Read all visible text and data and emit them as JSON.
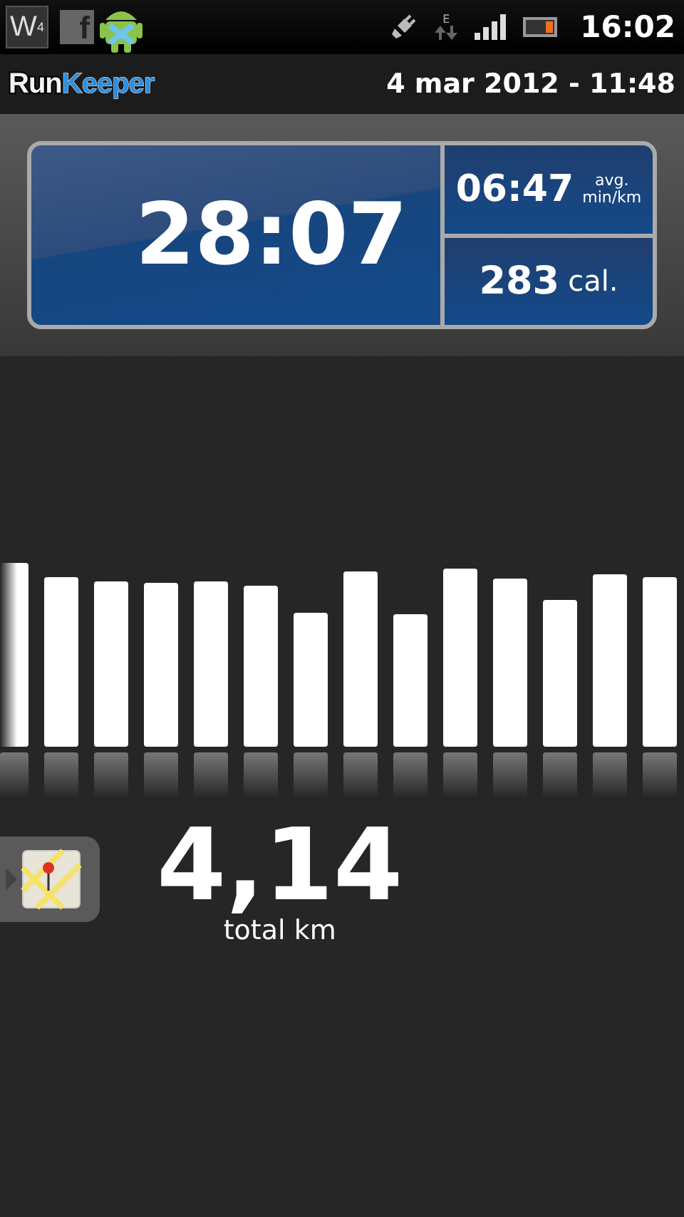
{
  "status_bar": {
    "app_badge": "W$^{4}$",
    "social_badge": "f",
    "network_type": "E",
    "time": "16:02"
  },
  "header": {
    "logo": {
      "first": "Run",
      "second": "Keeper"
    },
    "date": "4 mar 2012 - 11:48"
  },
  "stats": {
    "duration": "28:07",
    "pace": {
      "value": "06:47",
      "unit_top": "avg.",
      "unit_bottom": "min/km"
    },
    "calories": {
      "value": "283",
      "unit": "cal."
    }
  },
  "distance": {
    "value": "4,14",
    "label": "total km"
  }
}
